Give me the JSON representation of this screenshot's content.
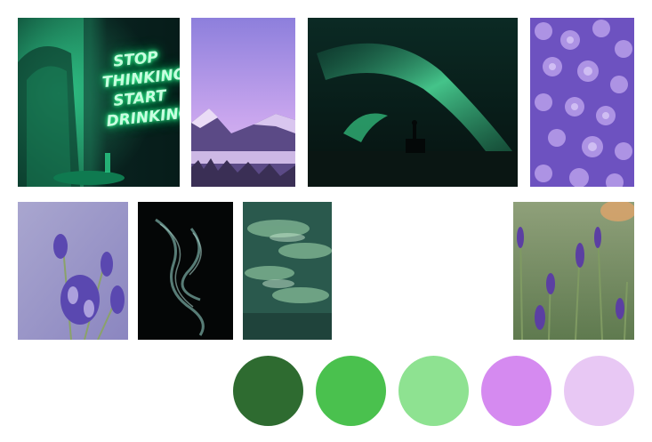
{
  "neon_sign": {
    "lines": [
      "STOP",
      "THINKING",
      "START",
      "DRINKING"
    ]
  },
  "photos": [
    {
      "name": "neon-sign-photo",
      "colors": [
        "#0b3a2c",
        "#1f8a5a",
        "#39ffb0"
      ]
    },
    {
      "name": "purple-mountains-photo",
      "colors": [
        "#8f78d6",
        "#c4a6ea",
        "#3a2f5a"
      ]
    },
    {
      "name": "aurora-photo",
      "colors": [
        "#0a1f1c",
        "#2fae78",
        "#0d1e18"
      ]
    },
    {
      "name": "hydrangea-photo",
      "colors": [
        "#7a5cc8",
        "#b49ae8",
        "#5a3fa8"
      ]
    },
    {
      "name": "lavender-photo",
      "colors": [
        "#9a96c8",
        "#6a5bb0",
        "#b5b3d6"
      ]
    },
    {
      "name": "smoke-photo",
      "colors": [
        "#050707",
        "#5d8a83",
        "#0b1311"
      ]
    },
    {
      "name": "green-clouds-photo",
      "colors": [
        "#2c5a4e",
        "#8bbf98",
        "#1f4439"
      ]
    },
    {
      "name": "lavender-field-photo",
      "colors": [
        "#6f8a5c",
        "#a7b58d",
        "#6a52a8"
      ]
    }
  ],
  "palette": [
    {
      "name": "dark-green",
      "color": "#2e6b30"
    },
    {
      "name": "green",
      "color": "#4ac14e"
    },
    {
      "name": "light-green",
      "color": "#8ee291"
    },
    {
      "name": "violet",
      "color": "#d58af0"
    },
    {
      "name": "lilac",
      "color": "#e8c8f4"
    }
  ]
}
